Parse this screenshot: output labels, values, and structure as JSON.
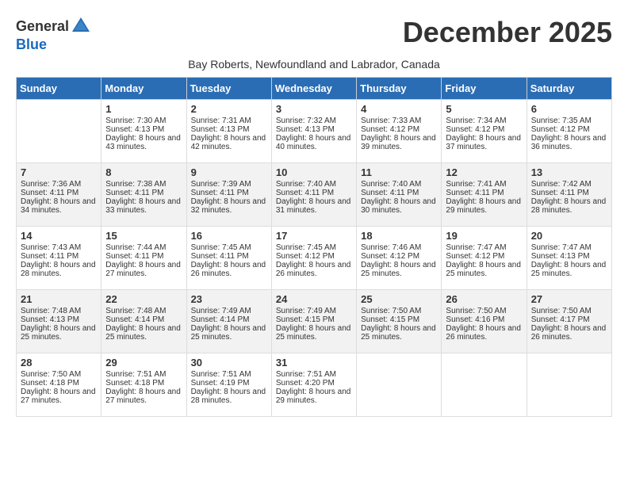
{
  "logo": {
    "general": "General",
    "blue": "Blue"
  },
  "title": "December 2025",
  "subtitle": "Bay Roberts, Newfoundland and Labrador, Canada",
  "days_of_week": [
    "Sunday",
    "Monday",
    "Tuesday",
    "Wednesday",
    "Thursday",
    "Friday",
    "Saturday"
  ],
  "weeks": [
    [
      {
        "day": "",
        "empty": true
      },
      {
        "day": "1",
        "sunrise": "Sunrise: 7:30 AM",
        "sunset": "Sunset: 4:13 PM",
        "daylight": "Daylight: 8 hours and 43 minutes."
      },
      {
        "day": "2",
        "sunrise": "Sunrise: 7:31 AM",
        "sunset": "Sunset: 4:13 PM",
        "daylight": "Daylight: 8 hours and 42 minutes."
      },
      {
        "day": "3",
        "sunrise": "Sunrise: 7:32 AM",
        "sunset": "Sunset: 4:13 PM",
        "daylight": "Daylight: 8 hours and 40 minutes."
      },
      {
        "day": "4",
        "sunrise": "Sunrise: 7:33 AM",
        "sunset": "Sunset: 4:12 PM",
        "daylight": "Daylight: 8 hours and 39 minutes."
      },
      {
        "day": "5",
        "sunrise": "Sunrise: 7:34 AM",
        "sunset": "Sunset: 4:12 PM",
        "daylight": "Daylight: 8 hours and 37 minutes."
      },
      {
        "day": "6",
        "sunrise": "Sunrise: 7:35 AM",
        "sunset": "Sunset: 4:12 PM",
        "daylight": "Daylight: 8 hours and 36 minutes."
      }
    ],
    [
      {
        "day": "7",
        "sunrise": "Sunrise: 7:36 AM",
        "sunset": "Sunset: 4:11 PM",
        "daylight": "Daylight: 8 hours and 34 minutes."
      },
      {
        "day": "8",
        "sunrise": "Sunrise: 7:38 AM",
        "sunset": "Sunset: 4:11 PM",
        "daylight": "Daylight: 8 hours and 33 minutes."
      },
      {
        "day": "9",
        "sunrise": "Sunrise: 7:39 AM",
        "sunset": "Sunset: 4:11 PM",
        "daylight": "Daylight: 8 hours and 32 minutes."
      },
      {
        "day": "10",
        "sunrise": "Sunrise: 7:40 AM",
        "sunset": "Sunset: 4:11 PM",
        "daylight": "Daylight: 8 hours and 31 minutes."
      },
      {
        "day": "11",
        "sunrise": "Sunrise: 7:40 AM",
        "sunset": "Sunset: 4:11 PM",
        "daylight": "Daylight: 8 hours and 30 minutes."
      },
      {
        "day": "12",
        "sunrise": "Sunrise: 7:41 AM",
        "sunset": "Sunset: 4:11 PM",
        "daylight": "Daylight: 8 hours and 29 minutes."
      },
      {
        "day": "13",
        "sunrise": "Sunrise: 7:42 AM",
        "sunset": "Sunset: 4:11 PM",
        "daylight": "Daylight: 8 hours and 28 minutes."
      }
    ],
    [
      {
        "day": "14",
        "sunrise": "Sunrise: 7:43 AM",
        "sunset": "Sunset: 4:11 PM",
        "daylight": "Daylight: 8 hours and 28 minutes."
      },
      {
        "day": "15",
        "sunrise": "Sunrise: 7:44 AM",
        "sunset": "Sunset: 4:11 PM",
        "daylight": "Daylight: 8 hours and 27 minutes."
      },
      {
        "day": "16",
        "sunrise": "Sunrise: 7:45 AM",
        "sunset": "Sunset: 4:11 PM",
        "daylight": "Daylight: 8 hours and 26 minutes."
      },
      {
        "day": "17",
        "sunrise": "Sunrise: 7:45 AM",
        "sunset": "Sunset: 4:12 PM",
        "daylight": "Daylight: 8 hours and 26 minutes."
      },
      {
        "day": "18",
        "sunrise": "Sunrise: 7:46 AM",
        "sunset": "Sunset: 4:12 PM",
        "daylight": "Daylight: 8 hours and 25 minutes."
      },
      {
        "day": "19",
        "sunrise": "Sunrise: 7:47 AM",
        "sunset": "Sunset: 4:12 PM",
        "daylight": "Daylight: 8 hours and 25 minutes."
      },
      {
        "day": "20",
        "sunrise": "Sunrise: 7:47 AM",
        "sunset": "Sunset: 4:13 PM",
        "daylight": "Daylight: 8 hours and 25 minutes."
      }
    ],
    [
      {
        "day": "21",
        "sunrise": "Sunrise: 7:48 AM",
        "sunset": "Sunset: 4:13 PM",
        "daylight": "Daylight: 8 hours and 25 minutes."
      },
      {
        "day": "22",
        "sunrise": "Sunrise: 7:48 AM",
        "sunset": "Sunset: 4:14 PM",
        "daylight": "Daylight: 8 hours and 25 minutes."
      },
      {
        "day": "23",
        "sunrise": "Sunrise: 7:49 AM",
        "sunset": "Sunset: 4:14 PM",
        "daylight": "Daylight: 8 hours and 25 minutes."
      },
      {
        "day": "24",
        "sunrise": "Sunrise: 7:49 AM",
        "sunset": "Sunset: 4:15 PM",
        "daylight": "Daylight: 8 hours and 25 minutes."
      },
      {
        "day": "25",
        "sunrise": "Sunrise: 7:50 AM",
        "sunset": "Sunset: 4:15 PM",
        "daylight": "Daylight: 8 hours and 25 minutes."
      },
      {
        "day": "26",
        "sunrise": "Sunrise: 7:50 AM",
        "sunset": "Sunset: 4:16 PM",
        "daylight": "Daylight: 8 hours and 26 minutes."
      },
      {
        "day": "27",
        "sunrise": "Sunrise: 7:50 AM",
        "sunset": "Sunset: 4:17 PM",
        "daylight": "Daylight: 8 hours and 26 minutes."
      }
    ],
    [
      {
        "day": "28",
        "sunrise": "Sunrise: 7:50 AM",
        "sunset": "Sunset: 4:18 PM",
        "daylight": "Daylight: 8 hours and 27 minutes."
      },
      {
        "day": "29",
        "sunrise": "Sunrise: 7:51 AM",
        "sunset": "Sunset: 4:18 PM",
        "daylight": "Daylight: 8 hours and 27 minutes."
      },
      {
        "day": "30",
        "sunrise": "Sunrise: 7:51 AM",
        "sunset": "Sunset: 4:19 PM",
        "daylight": "Daylight: 8 hours and 28 minutes."
      },
      {
        "day": "31",
        "sunrise": "Sunrise: 7:51 AM",
        "sunset": "Sunset: 4:20 PM",
        "daylight": "Daylight: 8 hours and 29 minutes."
      },
      {
        "day": "",
        "empty": true
      },
      {
        "day": "",
        "empty": true
      },
      {
        "day": "",
        "empty": true
      }
    ]
  ]
}
